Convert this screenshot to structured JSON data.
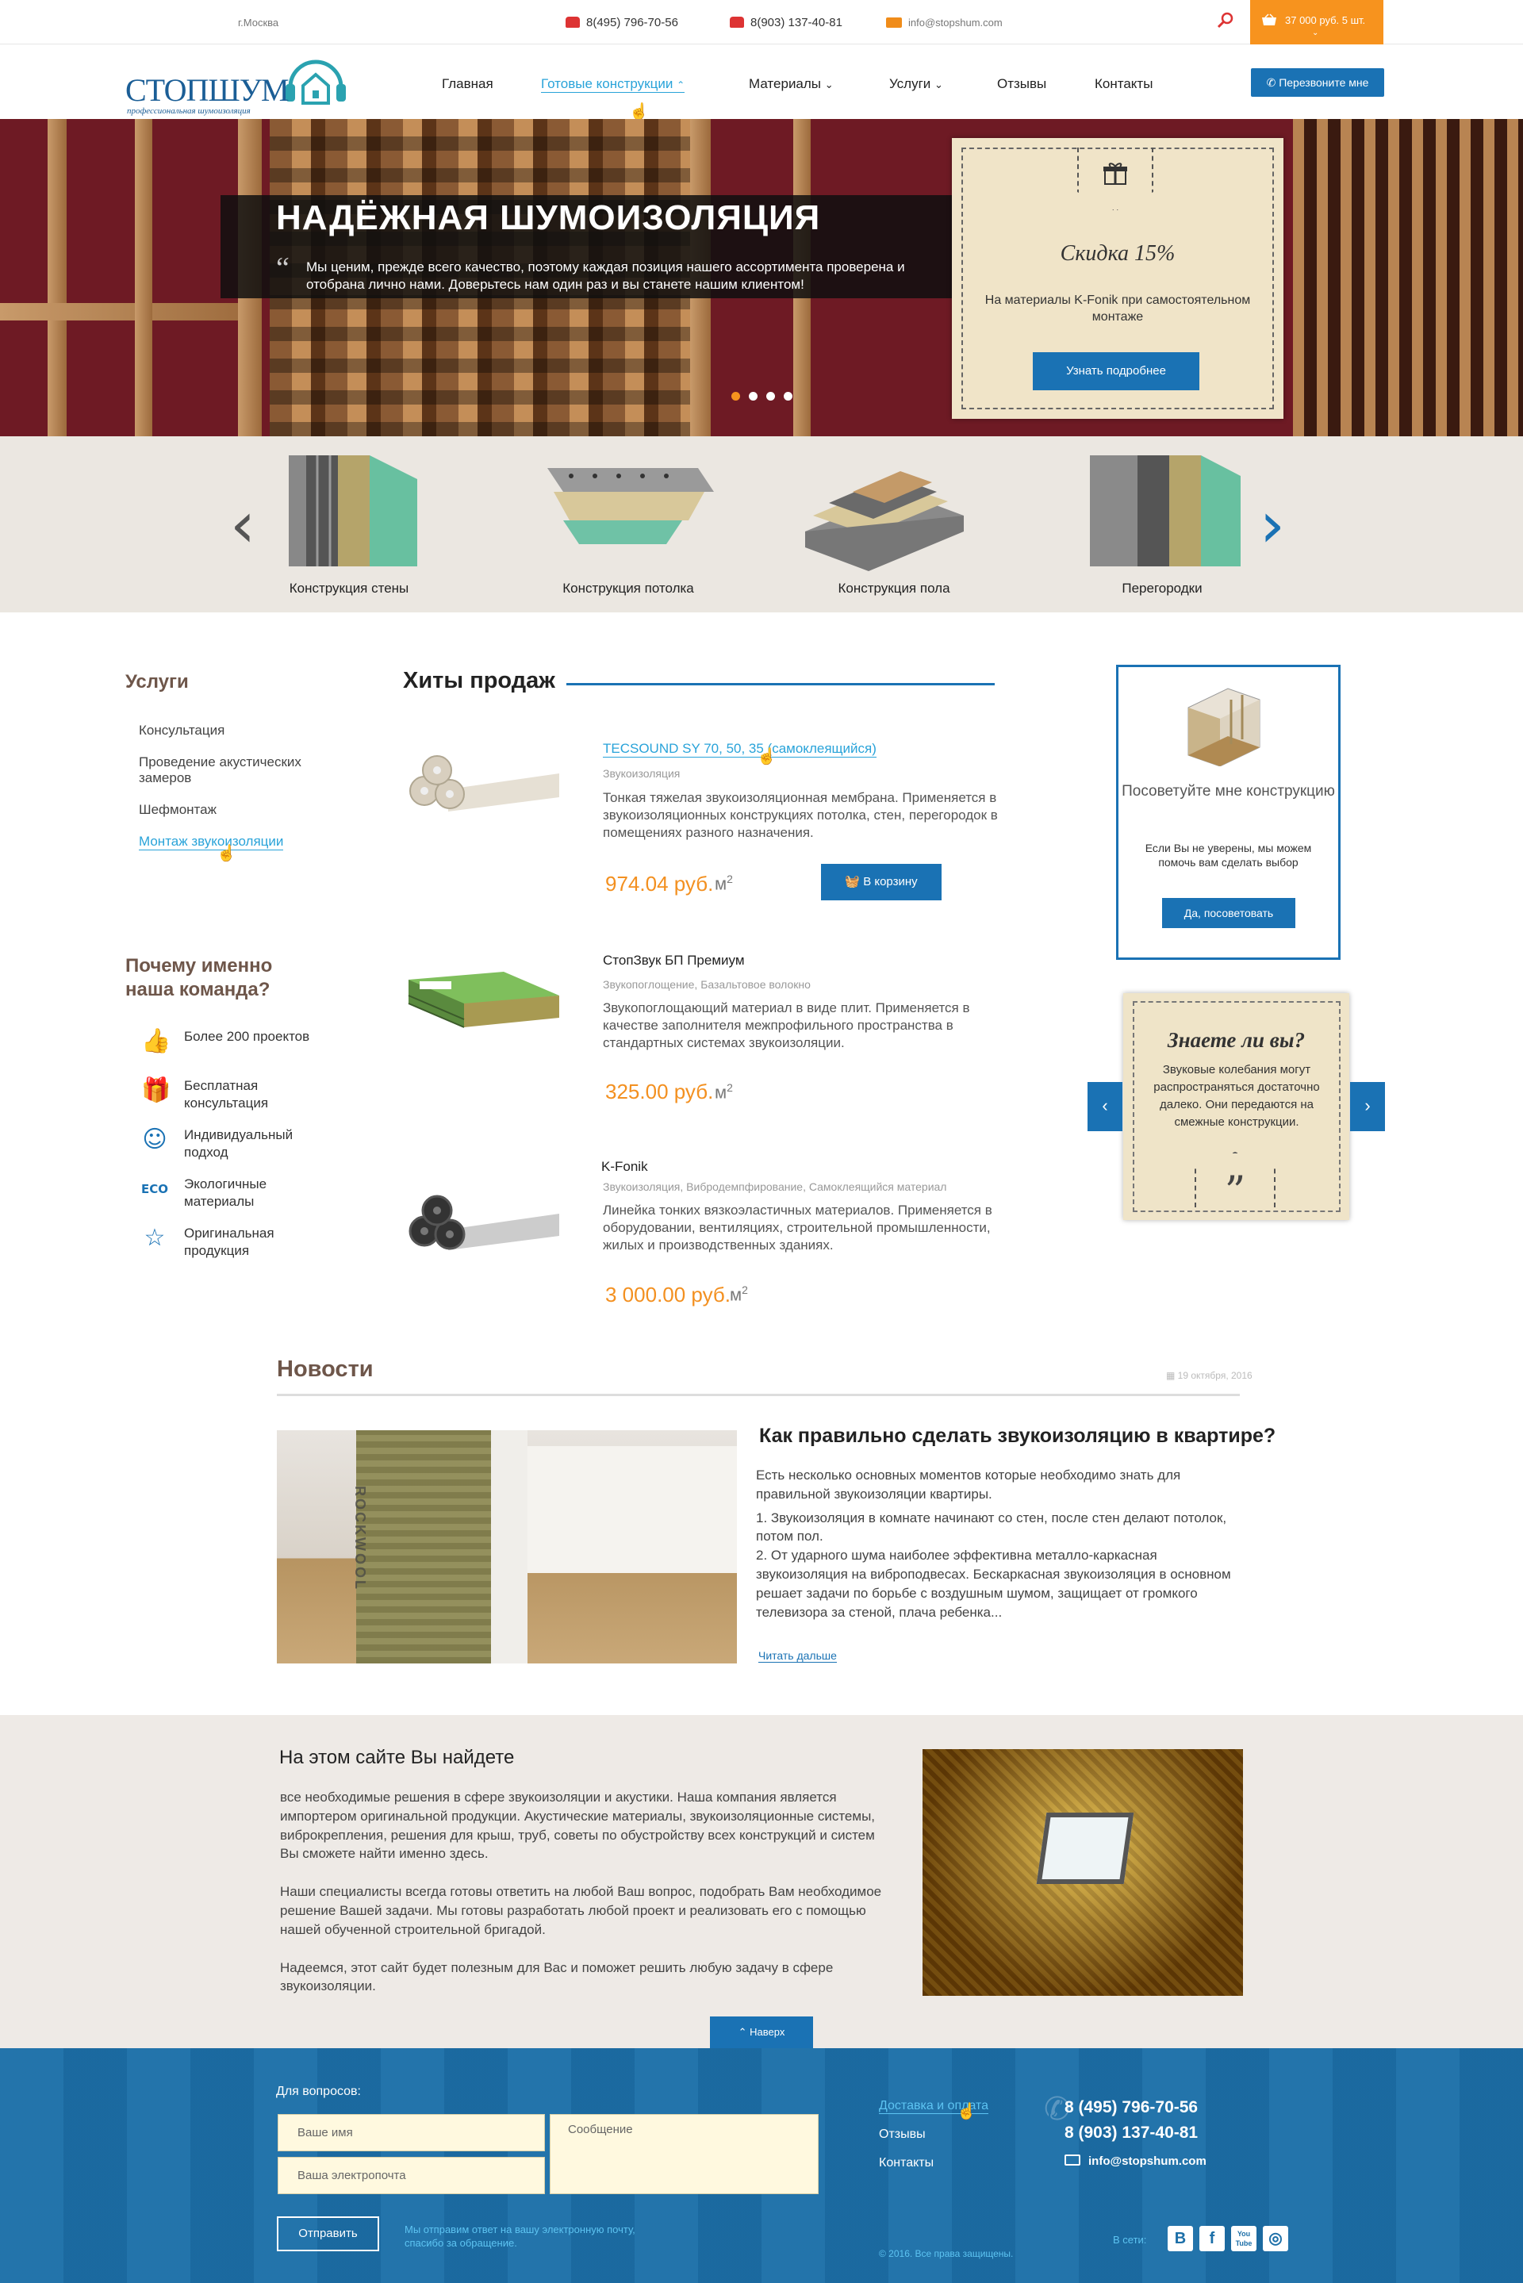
{
  "topbar": {
    "city": "г.Москва",
    "phone1": "8(495) 796-70-56",
    "phone2": "8(903) 137-40-81",
    "email": "info@stopshum.com",
    "cart": "37 000 руб. 5 шт."
  },
  "header": {
    "logo": "СТОПШУМ",
    "logo_sub": "профессиональная шумоизоляция",
    "nav": [
      "Главная",
      "Готовые конструкции",
      "Материалы",
      "Услуги",
      "Отзывы",
      "Контакты"
    ],
    "callback": "Перезвоните мне"
  },
  "hero": {
    "title": "НАДЁЖНАЯ ШУМОИЗОЛЯЦИЯ",
    "text": "Мы ценим, прежде всего качество, поэтому каждая позиция нашего ассортимента проверена и отобрана лично нами. Доверьтесь нам один раз и вы станете нашим клиентом!",
    "promo_title": "Скидка 15%",
    "promo_text": "На материалы K-Fonik при самостоятельном монтаже",
    "promo_button": "Узнать подробнее"
  },
  "carousel": {
    "items": [
      "Конструкция стены",
      "Конструкция потолка",
      "Конструкция пола",
      "Перегородки"
    ]
  },
  "services": {
    "title": "Услуги",
    "items": [
      "Консультация",
      "Проведение акустических замеров",
      "Шефмонтаж",
      "Монтаж звукоизоляции"
    ]
  },
  "why": {
    "title": "Почему именно наша команда?",
    "items": [
      "Более 200 проектов",
      "Бесплатная консультация",
      "Индивидуальный подход",
      "Экологичные материалы",
      "Оригинальная продукция"
    ],
    "icons": [
      "thumbs-up-icon",
      "gift-icon",
      "smile-icon",
      "eco-icon",
      "star-icon"
    ]
  },
  "hits": {
    "title": "Хиты продаж",
    "basket": "В корзину",
    "products": [
      {
        "name": "TECSOUND SY 70, 50, 35 (самоклеящийся)",
        "cat": "Звукоизоляция",
        "desc": "Тонкая тяжелая звукоизоляционная мембрана. Применяется в звукоизоляционных конструкциях потолка, стен, перегородок в помещениях разного назначения.",
        "price": "974.04 руб.",
        "unit": "м"
      },
      {
        "name": "СтопЗвук БП Премиум",
        "cat": "Звукопоглощение, Базальтовое волокно",
        "desc": "Звукопоглощающий материал в виде плит. Применяется в качестве заполнителя межпрофильного пространства в стандартных системах звукоизоляции.",
        "price": "325.00 руб.",
        "unit": "м"
      },
      {
        "name": "K-Fonik",
        "cat": "Звукоизоляция, Вибродемпфирование, Самоклеящийся материал",
        "desc": "Линейка тонких вязкоэластичных материалов. Применяется в оборудовании, вентиляциях, строительной промышленности, жилых и производственных зданиях.",
        "price": "3 000.00 руб.",
        "unit": "м"
      }
    ]
  },
  "advice": {
    "title": "Посоветуйте мне конструкцию",
    "text": "Если Вы не уверены, мы можем помочь вам сделать выбор",
    "button": "Да, посоветовать"
  },
  "know": {
    "title": "Знаете ли вы?",
    "text": "Звуковые колебания могут распространяться достаточно далеко. Они передаются на смежные конструкции."
  },
  "news": {
    "title": "Новости",
    "date": "19 октября, 2016",
    "heading": "Как правильно сделать звукоизоляцию в квартире?",
    "p1": "Есть несколько основных моментов которые необходимо знать для правильной звукоизоляции квартиры.",
    "p2": "1. Звукоизоляция в комнате начинают со стен, после стен делают потолок, потом пол.",
    "p3": "2. От ударного шума наиболее эффективна металло-каркасная звукоизоляция на виброподвесах. Бескаркасная звукоизоляция в основном решает задачи по борьбе с воздушным шумом, защищает от громкого телевизора за стеной, плача ребенка...",
    "more": "Читать дальше",
    "img_text": "ROCKWOOL"
  },
  "about": {
    "title": "На этом сайте Вы найдете",
    "p1": "все необходимые решения в сфере звукоизоляции и акустики. Наша компания является импортером оригинальной продукции. Акустические материалы, звукоизоляционные системы, виброкрепления, решения для крыш, труб, советы по обустройству всех конструкций и систем Вы сможете найти именно здесь.",
    "p2": "Наши специалисты всегда готовы ответить на любой Ваш вопрос, подобрать Вам необходимое решение Вашей задачи. Мы готовы разработать любой проект и реализовать его с помощью нашей обученной строительной бригадой.",
    "p3": "Надеемся, этот сайт будет полезным для Вас и поможет решить любую задачу в сфере звукоизоляции.",
    "totop": "Наверх"
  },
  "footer": {
    "label": "Для вопросов:",
    "name_ph": "Ваше имя",
    "email_ph": "Ваша электропочта",
    "msg_ph": "Сообщение",
    "send": "Отправить",
    "note": "Мы отправим ответ на вашу электронную почту, спасибо за обращение.",
    "links": [
      "Доставка и оплата",
      "Отзывы",
      "Контакты"
    ],
    "phone1": "8 (495) 796-70-56",
    "phone2": "8 (903) 137-40-81",
    "email": "info@stopshum.com",
    "social_label": "В сети:",
    "social": [
      "B",
      "f",
      "You Tube",
      "◎"
    ],
    "copyright": "© 2016. Все права защищены."
  },
  "colors": {
    "primary": "#1a72b4",
    "accent": "#f7931e",
    "link": "#29a3d9",
    "footer": "#1c6fa8"
  }
}
